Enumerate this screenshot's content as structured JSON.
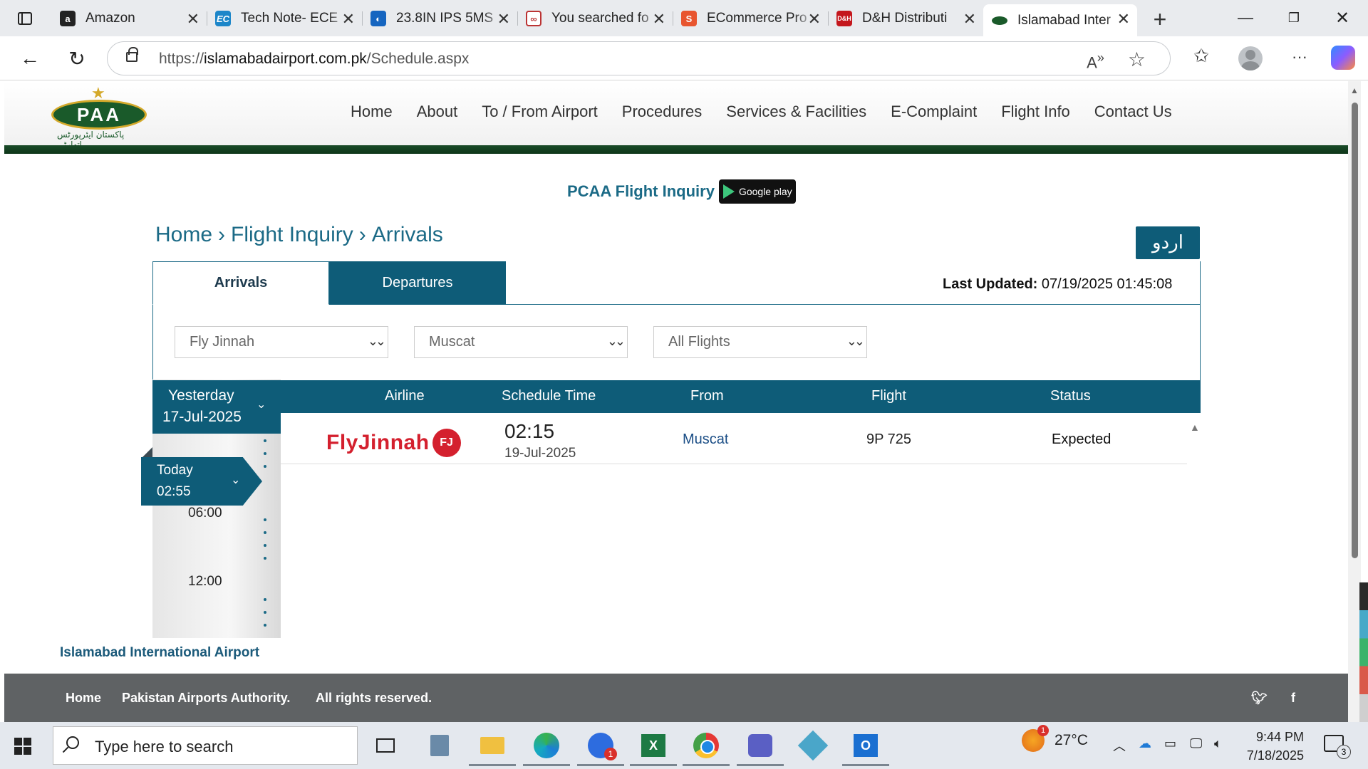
{
  "browser": {
    "tabs": [
      {
        "title": "Amazon",
        "icon": "amazon-icon"
      },
      {
        "title": "Tech Note- ECE",
        "icon": "ec-icon"
      },
      {
        "title": "23.8IN IPS 5MS",
        "icon": "cloud-icon"
      },
      {
        "title": "You searched fo",
        "icon": "search-app-icon"
      },
      {
        "title": "ECommerce Pro",
        "icon": "ecommerce-icon"
      },
      {
        "title": "D&H Distributi",
        "icon": "dh-icon"
      },
      {
        "title": "Islamabad Inter",
        "icon": "paa-icon"
      }
    ],
    "url_prefix": "https://",
    "url_host": "islamabadairport.com.pk",
    "url_path": "/Schedule.aspx"
  },
  "site": {
    "logo_text": "PAA",
    "logo_urdu": "پاکستان ایئرپورٹس اتھارٹی",
    "menu": [
      "Home",
      "About",
      "To / From Airport",
      "Procedures",
      "Services & Facilities",
      "E-Complaint",
      "Flight Info",
      "Contact Us"
    ],
    "inquiry_label": "PCAA Flight Inquiry",
    "gplay_label": "Google play",
    "breadcrumb": [
      "Home",
      "Flight Inquiry",
      "Arrivals"
    ],
    "breadcrumb_sep": "›",
    "urdu_button": "اردو",
    "tabs": {
      "arrivals": "Arrivals",
      "departures": "Departures"
    },
    "last_updated_label": "Last Updated:",
    "last_updated_value": "07/19/2025 01:45:08",
    "filters": {
      "airline": "Fly Jinnah",
      "city": "Muscat",
      "flight_type": "All Flights"
    },
    "timeline": {
      "yesterday_label": "Yesterday",
      "yesterday_date": "17-Jul-2025",
      "today_label": "Today",
      "today_time": "02:55",
      "ticks": [
        "06:00",
        "12:00"
      ]
    },
    "table": {
      "headers": [
        "Airline",
        "Schedule Time",
        "From",
        "Flight",
        "Status"
      ],
      "rows": [
        {
          "airline": "FlyJinnah",
          "airline_badge": "FJ",
          "time": "02:15",
          "date": "19-Jul-2025",
          "from": "Muscat",
          "flight": "9P 725",
          "status": "Expected"
        }
      ]
    },
    "airport_name": "Islamabad International Airport",
    "footer": [
      "Home",
      "Pakistan Airports Authority.",
      "All rights reserved."
    ]
  },
  "taskbar": {
    "search_placeholder": "Type here to search",
    "weather_temp": "27°C",
    "weather_badge": "1",
    "zoom_badge": "1",
    "time": "9:44 PM",
    "date": "7/18/2025",
    "notifications": "3"
  },
  "colors": {
    "brand_teal": "#0e5c78",
    "link": "#1b6a86",
    "flyjinnah_red": "#d4202e",
    "header_green": "#1a4b28"
  }
}
